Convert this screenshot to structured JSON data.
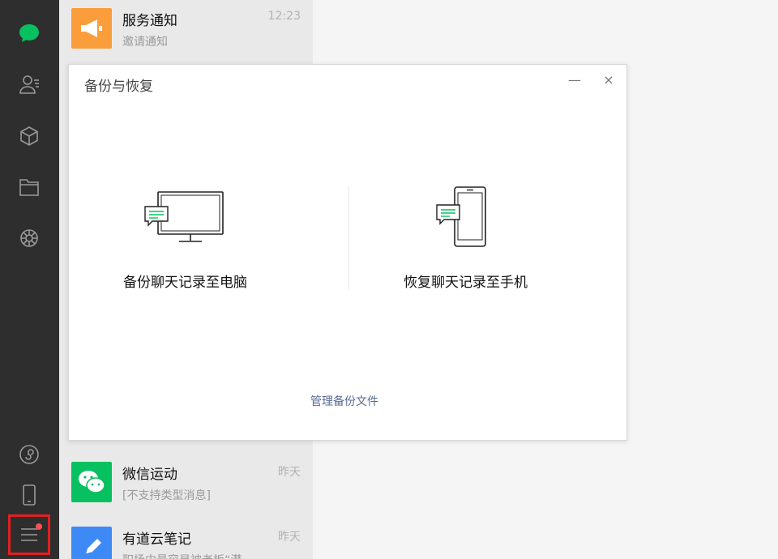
{
  "sidebar": {
    "icons": [
      "chat-icon",
      "contacts-icon",
      "favorites-icon",
      "files-icon",
      "moments-icon",
      "mini-program-icon",
      "phone-icon",
      "menu-icon"
    ],
    "accent_color": "#07c160",
    "badge_color": "#fa5151"
  },
  "chats": [
    {
      "name": "服务通知",
      "preview": "邀请通知",
      "time": "12:23",
      "avatar_color": "#fa9d3b",
      "icon": "megaphone-icon"
    },
    {
      "name": "微信运动",
      "preview": "[不支持类型消息]",
      "time": "昨天",
      "avatar_color": "#07c160",
      "icon": "wechat-icon"
    },
    {
      "name": "有道云笔记",
      "preview": "职场中最容易被老板“潜",
      "time": "昨天",
      "avatar_color": "#3d8af7",
      "icon": "pen-icon"
    }
  ],
  "dialog": {
    "title": "备份与恢复",
    "minimize_label": "—",
    "close_label": "×",
    "backup_label": "备份聊天记录至电脑",
    "restore_label": "恢复聊天记录至手机",
    "manage_label": "管理备份文件"
  }
}
